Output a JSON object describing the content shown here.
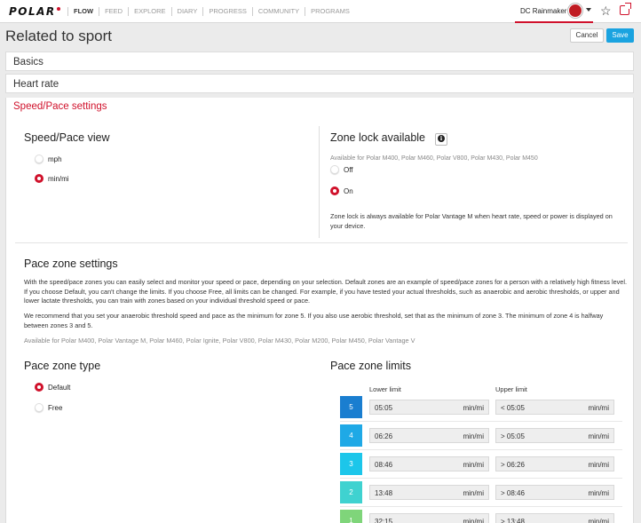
{
  "nav": {
    "logo": "POLAR",
    "links": [
      "FLOW",
      "FEED",
      "EXPLORE",
      "DIARY",
      "PROGRESS",
      "COMMUNITY",
      "PROGRAMS"
    ],
    "user_name": "DC Rainmaker",
    "accent": "#d0112b"
  },
  "header": {
    "title": "Related to sport",
    "cancel": "Cancel",
    "save": "Save"
  },
  "sections": {
    "basics": "Basics",
    "heart_rate": "Heart rate",
    "speed_pace": "Speed/Pace settings"
  },
  "speed_view": {
    "title": "Speed/Pace view",
    "options": [
      "mph",
      "min/mi"
    ],
    "selected": "min/mi"
  },
  "zone_lock": {
    "title": "Zone lock available",
    "available": "Available for Polar M400, Polar M460, Polar V800, Polar M430, Polar M450",
    "options": [
      "Off",
      "On"
    ],
    "selected": "On",
    "note": "Zone lock is always available for Polar Vantage M when heart rate, speed or power is displayed on your device."
  },
  "pace_zone_settings": {
    "title": "Pace zone settings",
    "p1": "With the speed/pace zones you can easily select and monitor your speed or pace, depending on your selection. Default zones are an example of speed/pace zones for a person with a relatively high fitness level. If you choose Default, you can't change the limits. If you choose Free, all limits can be changed. For example, if you have tested your actual thresholds, such as anaerobic and aerobic thresholds, or upper and lower lactate thresholds, you can train with zones based on your individual threshold speed or pace.",
    "p2": "We recommend that you set your anaerobic threshold speed and pace as the minimum for zone 5. If you also use aerobic threshold, set that as the minimum of zone 3. The minimum of zone 4 is halfway between zones 3 and 5.",
    "available": "Available for Polar M400, Polar Vantage M, Polar M460, Polar Ignite, Polar V800, Polar M430, Polar M200, Polar M450, Polar Vantage V"
  },
  "pace_zone_type": {
    "title": "Pace zone type",
    "options": [
      "Default",
      "Free"
    ],
    "selected": "Default"
  },
  "pace_zone_limits": {
    "title": "Pace zone limits",
    "lower_label": "Lower limit",
    "upper_label": "Upper limit",
    "unit": "min/mi",
    "zones": [
      {
        "zone": "5",
        "lower": "05:05",
        "upper": "< 05:05",
        "color": "#1a7ed0"
      },
      {
        "zone": "4",
        "lower": "06:26",
        "upper": "> 05:05",
        "color": "#1fa9e6"
      },
      {
        "zone": "3",
        "lower": "08:46",
        "upper": "> 06:26",
        "color": "#1cc6ea"
      },
      {
        "zone": "2",
        "lower": "13:48",
        "upper": "> 08:46",
        "color": "#3fd2d0"
      },
      {
        "zone": "1",
        "lower": "32:15",
        "upper": "> 13:48",
        "color": "#7fd57a"
      }
    ]
  }
}
